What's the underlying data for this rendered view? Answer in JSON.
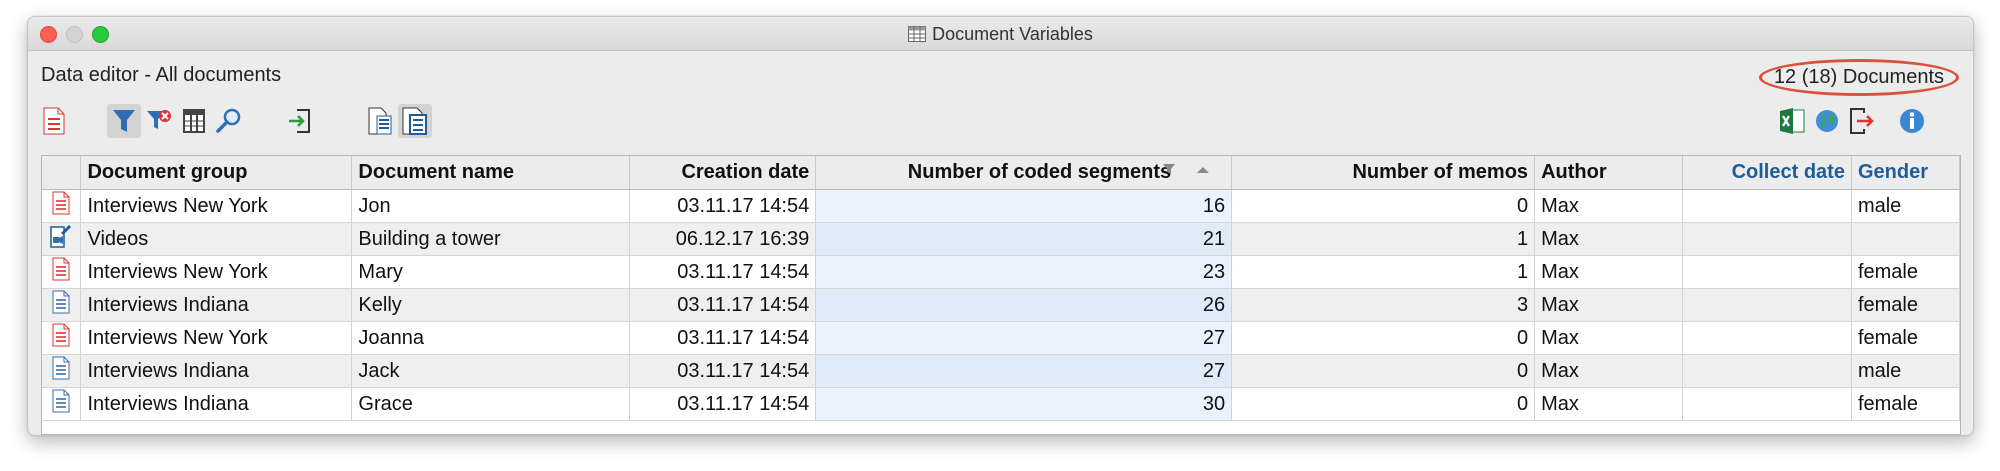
{
  "window": {
    "title": "Document Variables"
  },
  "header": {
    "subtitle": "Data editor - All documents",
    "doc_count": "12 (18) Documents"
  },
  "toolbar_left": [
    "document-red-icon",
    "filter-icon",
    "clear-filter-icon",
    "columns-table-icon",
    "search-icon",
    "import-icon",
    "list-view-icon",
    "document-view-icon"
  ],
  "toolbar_right": [
    "excel-export-icon",
    "web-export-icon",
    "export-exit-icon",
    "info-icon"
  ],
  "table": {
    "columns": [
      "Document group",
      "Document name",
      "Creation date",
      "Number of coded segments",
      "Number of memos",
      "Author",
      "Collect date",
      "Gender"
    ],
    "rows": [
      {
        "icon": "text-doc-red-icon",
        "group": "Interviews New York",
        "name": "Jon",
        "date": "03.11.17 14:54",
        "segments": "16",
        "memos": "0",
        "author": "Max",
        "collect": "",
        "gender": "male"
      },
      {
        "icon": "video-doc-icon",
        "group": "Videos",
        "name": "Building a tower",
        "date": "06.12.17 16:39",
        "segments": "21",
        "memos": "1",
        "author": "Max",
        "collect": "",
        "gender": ""
      },
      {
        "icon": "text-doc-red-icon",
        "group": "Interviews New York",
        "name": "Mary",
        "date": "03.11.17 14:54",
        "segments": "23",
        "memos": "1",
        "author": "Max",
        "collect": "",
        "gender": "female"
      },
      {
        "icon": "text-doc-blue-icon",
        "group": "Interviews Indiana",
        "name": "Kelly",
        "date": "03.11.17 14:54",
        "segments": "26",
        "memos": "3",
        "author": "Max",
        "collect": "",
        "gender": "female"
      },
      {
        "icon": "text-doc-red-icon",
        "group": "Interviews New York",
        "name": "Joanna",
        "date": "03.11.17 14:54",
        "segments": "27",
        "memos": "0",
        "author": "Max",
        "collect": "",
        "gender": "female"
      },
      {
        "icon": "text-doc-blue-icon",
        "group": "Interviews Indiana",
        "name": "Jack",
        "date": "03.11.17 14:54",
        "segments": "27",
        "memos": "0",
        "author": "Max",
        "collect": "",
        "gender": "male"
      },
      {
        "icon": "text-doc-blue-icon",
        "group": "Interviews Indiana",
        "name": "Grace",
        "date": "03.11.17 14:54",
        "segments": "30",
        "memos": "0",
        "author": "Max",
        "collect": "",
        "gender": "female"
      }
    ]
  },
  "colors": {
    "accent_blue": "#1f5c9a",
    "selection": "#e8f3fd",
    "highlight_ring": "#d9533c"
  }
}
